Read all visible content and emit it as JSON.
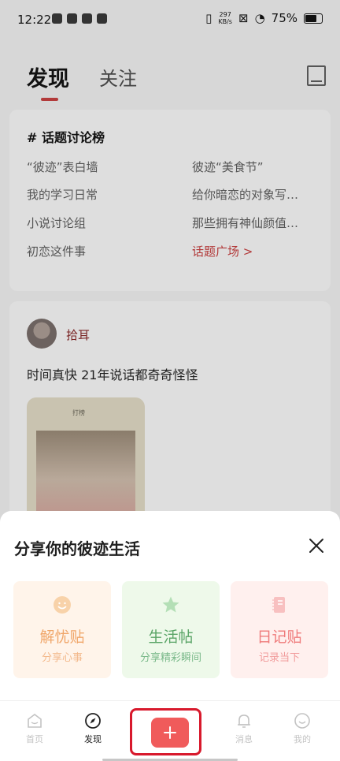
{
  "status_bar": {
    "time": "12:22",
    "net_speed_value": "297",
    "net_speed_unit": "KB/s",
    "battery": "75%"
  },
  "header": {
    "tab_discover": "发现",
    "tab_follow": "关注",
    "book_icon": "book-icon"
  },
  "topics": {
    "title": "# 话题讨论榜",
    "items": [
      "“彼迹”表白墙",
      "彼迹“美食节”",
      "我的学习日常",
      "给你暗恋的对象写…",
      "小说讨论组",
      "那些拥有神仙颜值…",
      "初恋这件事"
    ],
    "more_link": "话题广场 >"
  },
  "post": {
    "author": "拾耳",
    "text": "时间真快 21年说话都奇奇怪怪",
    "image_tag": "打榜"
  },
  "sheet": {
    "title": "分享你的彼迹生活",
    "options": [
      {
        "label": "解忧贴",
        "sub": "分享心事",
        "icon": "smile-icon",
        "color": "#f0a76b"
      },
      {
        "label": "生活帖",
        "sub": "分享精彩瞬间",
        "icon": "star-icon",
        "color": "#59a466"
      },
      {
        "label": "日记贴",
        "sub": "记录当下",
        "icon": "diary-icon",
        "color": "#ef7b7b"
      }
    ]
  },
  "bottom_nav": {
    "home": "首页",
    "discover": "发现",
    "message": "消息",
    "mine": "我的",
    "add_color": "#f05b5b"
  }
}
